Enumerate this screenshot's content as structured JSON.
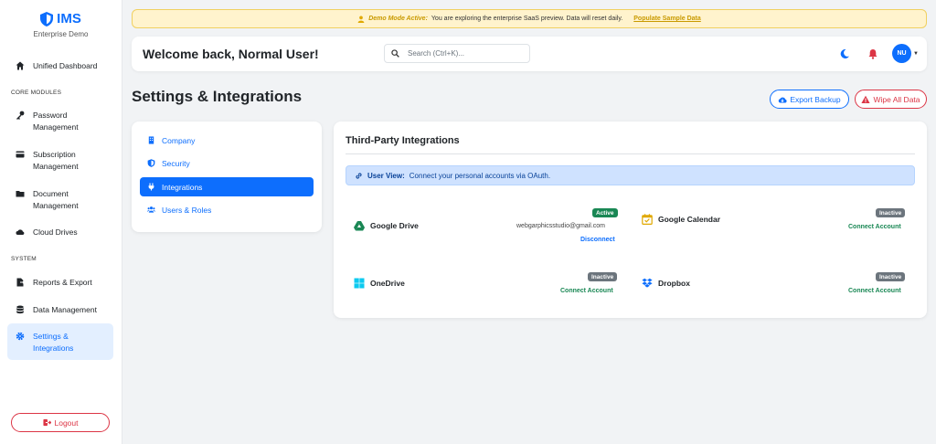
{
  "app": {
    "name": "IMS",
    "subtitle": "Enterprise Demo"
  },
  "sidebar": {
    "dashboard": "Unified Dashboard",
    "core_label": "CORE MODULES",
    "password": "Password\nManagement",
    "subscription": "Subscription\nManagement",
    "document": "Document\nManagement",
    "cloud": "Cloud Drives",
    "system_label": "SYSTEM",
    "reports": "Reports & Export",
    "data_mgmt": "Data Management",
    "settings": "Settings &\nIntegrations",
    "logout": "Logout"
  },
  "banner": {
    "strong": "Demo Mode Active:",
    "text": "You are exploring the enterprise SaaS preview. Data will reset daily.",
    "link": "Populate Sample Data"
  },
  "header": {
    "welcome": "Welcome back, Normal User!",
    "search_placeholder": "Search (Ctrl+K)...",
    "avatar_initials": "NU"
  },
  "page": {
    "title": "Settings & Integrations",
    "export_label": "Export Backup",
    "wipe_label": "Wipe All Data"
  },
  "settings_menu": {
    "company": "Company",
    "security": "Security",
    "integrations": "Integrations",
    "users": "Users & Roles"
  },
  "integrations": {
    "title": "Third-Party Integrations",
    "info_strong": "User View:",
    "info_text": "Connect your personal accounts via OAuth.",
    "services": {
      "google_drive": {
        "name": "Google Drive",
        "status": "Active",
        "email": "webgarphicsstudio@gmail.com",
        "action": "Disconnect"
      },
      "google_calendar": {
        "name": "Google Calendar",
        "status": "Inactive",
        "action": "Connect Account"
      },
      "onedrive": {
        "name": "OneDrive",
        "status": "Inactive",
        "action": "Connect Account"
      },
      "dropbox": {
        "name": "Dropbox",
        "status": "Inactive",
        "action": "Connect Account"
      }
    }
  },
  "colors": {
    "primary": "#0d6efd",
    "danger": "#dc3545",
    "success": "#198754",
    "warning_bg": "#fff3cd",
    "info_bg": "#cfe2ff"
  }
}
